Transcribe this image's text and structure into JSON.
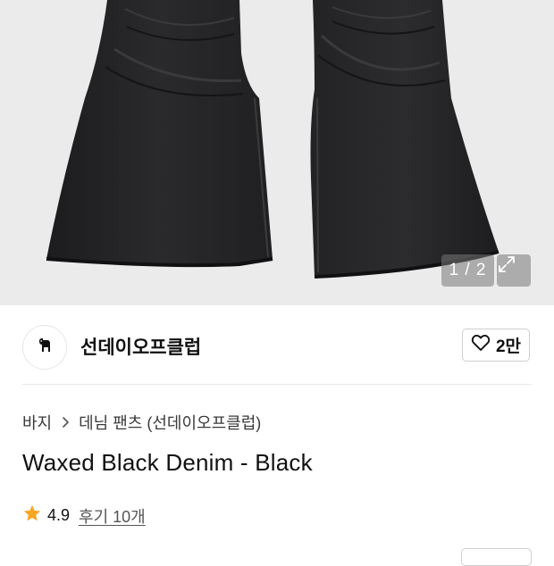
{
  "gallery": {
    "counter": "1 / 2",
    "image_alt": "black flared denim jeans",
    "expand_icon": "expand-icon"
  },
  "brand": {
    "name": "선데이오프클럽",
    "logo_icon": "dog-logo-icon",
    "like_icon": "heart-icon",
    "like_count": "2만"
  },
  "breadcrumb": {
    "category": "바지",
    "separator_icon": "chevron-right-icon",
    "subcategory": "데님 팬츠 (선데이오프클럽)"
  },
  "product": {
    "title": "Waxed Black Denim - Black"
  },
  "rating": {
    "star_icon": "star-icon",
    "star_color": "#f5a623",
    "score": "4.9",
    "reviews": "후기 10개"
  }
}
